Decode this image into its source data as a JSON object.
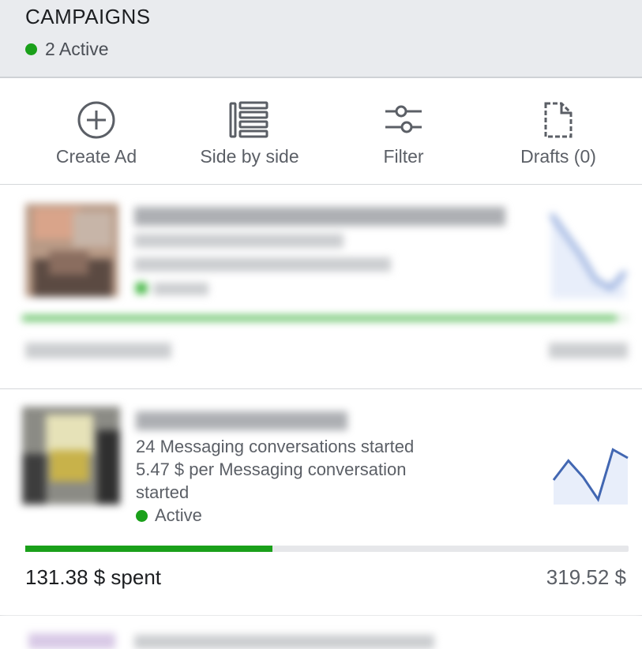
{
  "header": {
    "title": "CAMPAIGNS",
    "active_count_label": "2 Active"
  },
  "toolbar": {
    "items": [
      {
        "label": "Create Ad",
        "icon": "plus-circle-icon"
      },
      {
        "label": "Side by side",
        "icon": "list-compare-icon"
      },
      {
        "label": "Filter",
        "icon": "sliders-icon"
      },
      {
        "label": "Drafts (0)",
        "icon": "document-icon"
      }
    ]
  },
  "campaigns": [
    {
      "name": "",
      "metric_line_1": "",
      "metric_line_2": "",
      "status": "",
      "spent": "",
      "budget": "",
      "progress": 0.98,
      "blurred": true,
      "sparkline": [
        0.95,
        0.7,
        0.45,
        0.15,
        0.05,
        0.25
      ]
    },
    {
      "name": "",
      "metric_line_1": "24 Messaging conversations started",
      "metric_line_2": "5.47 $ per Messaging conversation",
      "metric_line_3": "started",
      "status": "Active",
      "spent": "131.38 $ spent",
      "budget": "319.52 $",
      "progress": 0.41,
      "blurred": false,
      "sparkline": [
        0.4,
        0.75,
        0.45,
        0.05,
        0.95,
        0.8
      ]
    }
  ],
  "colors": {
    "active_green": "#1aa01a",
    "sparkline_blue": "#4267b2"
  }
}
